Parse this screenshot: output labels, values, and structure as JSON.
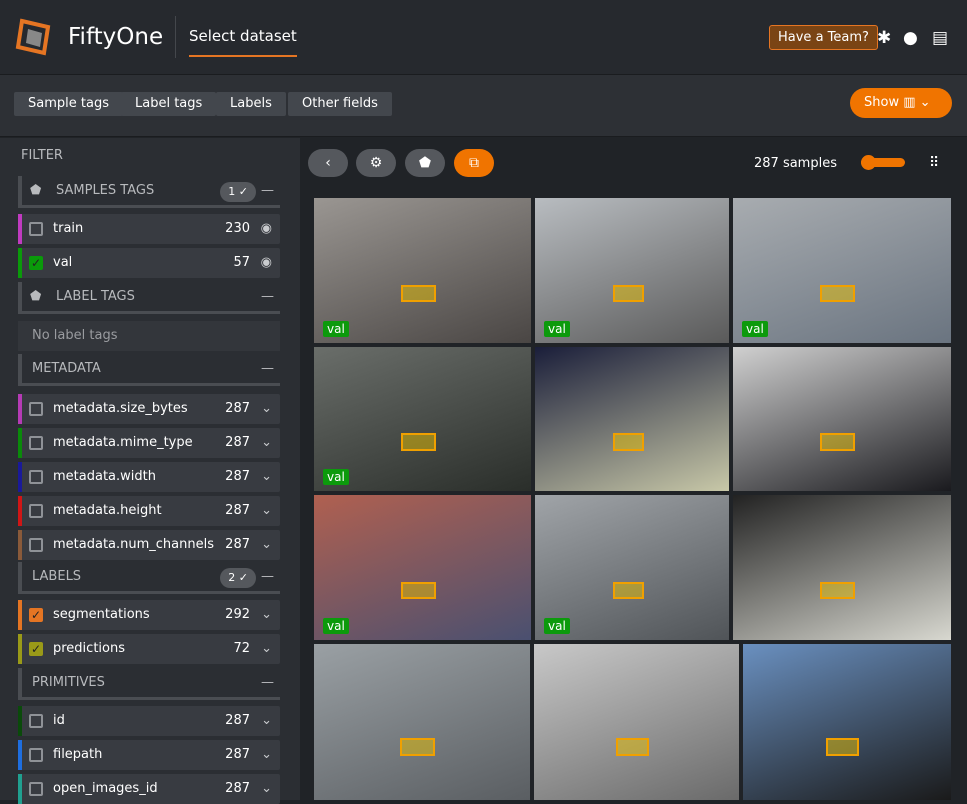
{
  "header": {
    "brand": "FiftyOne",
    "dataset_selector": "Select dataset",
    "team_button": "Have a Team?"
  },
  "toolbar": {
    "buttons": [
      "Sample tags",
      "Label tags",
      "Labels",
      "Other fields"
    ],
    "show_button": "Show"
  },
  "sidebar": {
    "title": "FILTER",
    "sample_tags": {
      "title": "SAMPLES TAGS",
      "badge": "1 ✓",
      "items": [
        {
          "label": "train",
          "count": "230",
          "checked": false,
          "color": "#c03bc0"
        },
        {
          "label": "val",
          "count": "57",
          "checked": true,
          "color": "#0a9a0a"
        }
      ]
    },
    "label_tags": {
      "title": "LABEL TAGS",
      "empty": "No label tags"
    },
    "metadata": {
      "title": "METADATA",
      "items": [
        {
          "label": "metadata.size_bytes",
          "count": "287",
          "color": "#b53bb5"
        },
        {
          "label": "metadata.mime_type",
          "count": "287",
          "color": "#0a8a0a"
        },
        {
          "label": "metadata.width",
          "count": "287",
          "color": "#1a1a9a"
        },
        {
          "label": "metadata.height",
          "count": "287",
          "color": "#d01616"
        },
        {
          "label": "metadata.num_channels",
          "count": "287",
          "color": "#8a5a3a"
        }
      ]
    },
    "labels": {
      "title": "LABELS",
      "badge": "2 ✓",
      "items": [
        {
          "label": "segmentations",
          "count": "292",
          "checked": true,
          "color": "#e57523"
        },
        {
          "label": "predictions",
          "count": "72",
          "checked": true,
          "color": "#9a9a18"
        }
      ]
    },
    "primitives": {
      "title": "PRIMITIVES",
      "items": [
        {
          "label": "id",
          "count": "287",
          "color": "#0a4a0a"
        },
        {
          "label": "filepath",
          "count": "287",
          "color": "#1e6ee0"
        },
        {
          "label": "open_images_id",
          "count": "287",
          "color": "#20a090"
        }
      ]
    }
  },
  "main": {
    "sample_count": "287 samples",
    "tag_label": "val"
  },
  "colors": {
    "accent": "#f07400"
  }
}
